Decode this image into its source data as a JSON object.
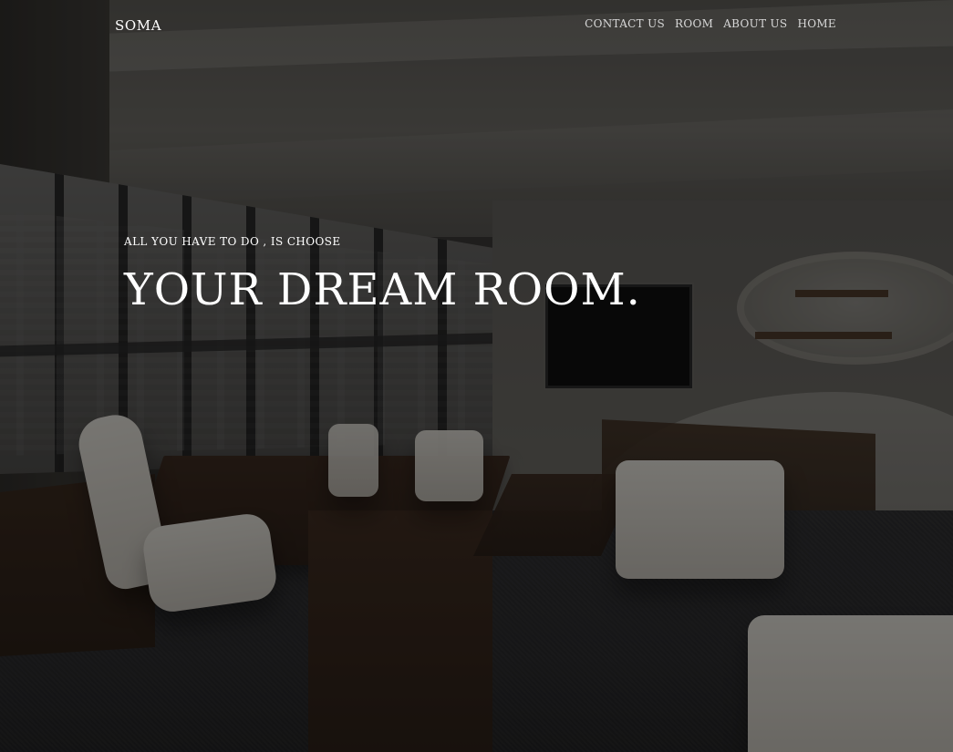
{
  "header": {
    "brand": "SOMA",
    "nav": [
      {
        "label": "CONTACT US"
      },
      {
        "label": "ROOM"
      },
      {
        "label": "ABOUT US"
      },
      {
        "label": "HOME"
      }
    ]
  },
  "hero": {
    "subtitle": "ALL YOU HAVE TO DO , IS CHOOSE",
    "title": "YOUR DREAM ROOM."
  },
  "colors": {
    "text_primary": "#ffffff",
    "nav_text": "#d7d7d7",
    "overlay": "rgba(0,0,0,0.45)"
  }
}
